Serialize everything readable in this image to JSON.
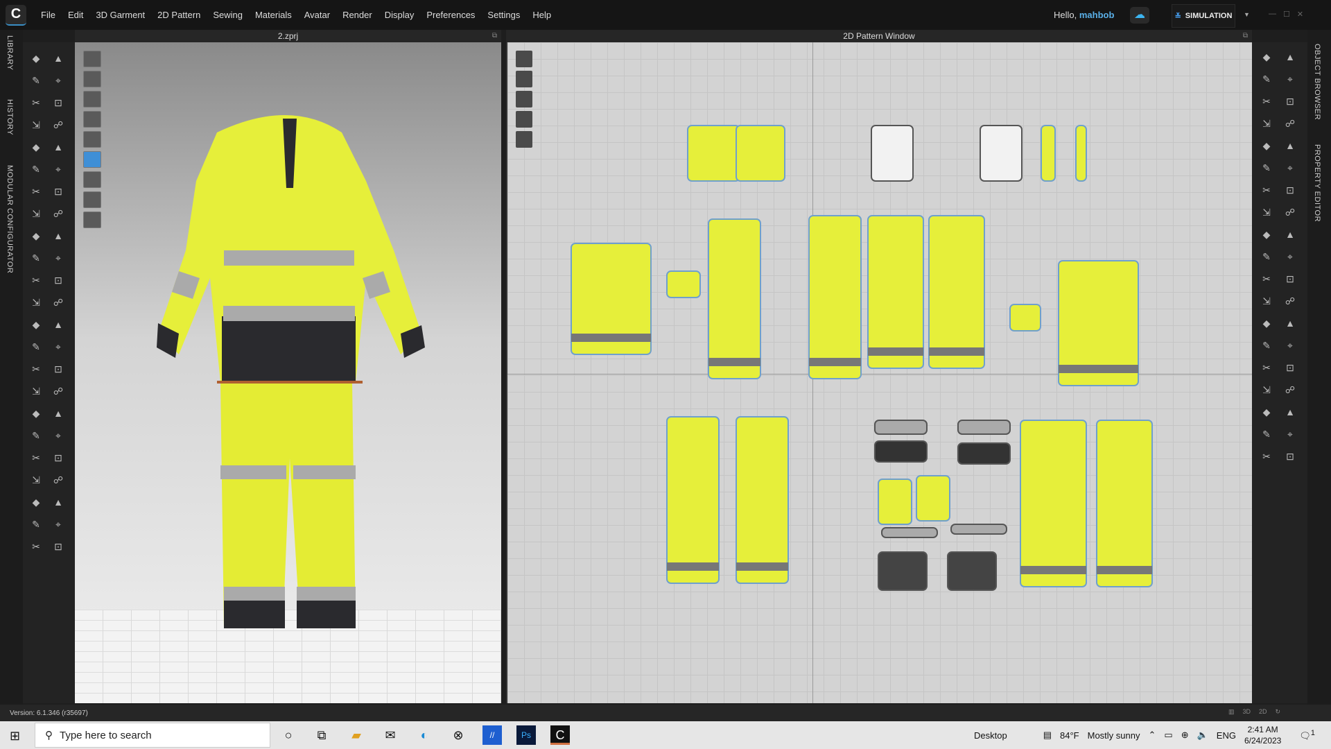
{
  "menubar": {
    "items": [
      "File",
      "Edit",
      "3D Garment",
      "2D Pattern",
      "Sewing",
      "Materials",
      "Avatar",
      "Render",
      "Display",
      "Preferences",
      "Settings",
      "Help"
    ],
    "greeting": "Hello,",
    "username": "mahbob",
    "mode": "SIMULATION"
  },
  "panels": {
    "viewport3d_title": "2.zprj",
    "pattern_title": "2D Pattern Window"
  },
  "left_tabs": [
    "LIBRARY",
    "HISTORY",
    "MODULAR CONFIGURATOR"
  ],
  "right_tabs": [
    "OBJECT BROWSER",
    "PROPERTY EDITOR"
  ],
  "status": {
    "version": "Version: 6.1.346 (r35697)",
    "view_buttons": [
      "3D",
      "2D"
    ]
  },
  "taskbar": {
    "search_placeholder": "Type here to search",
    "desktop": "Desktop",
    "temperature": "84°F",
    "weather": "Mostly sunny",
    "language": "ENG",
    "time": "2:41 AM",
    "date": "6/24/2023",
    "notifications": "1"
  },
  "colors": {
    "accent": "#3a8ec4",
    "fabric": "#e6ef3a",
    "reflective": "#a8a8a8",
    "dark": "#2a2a2e"
  }
}
